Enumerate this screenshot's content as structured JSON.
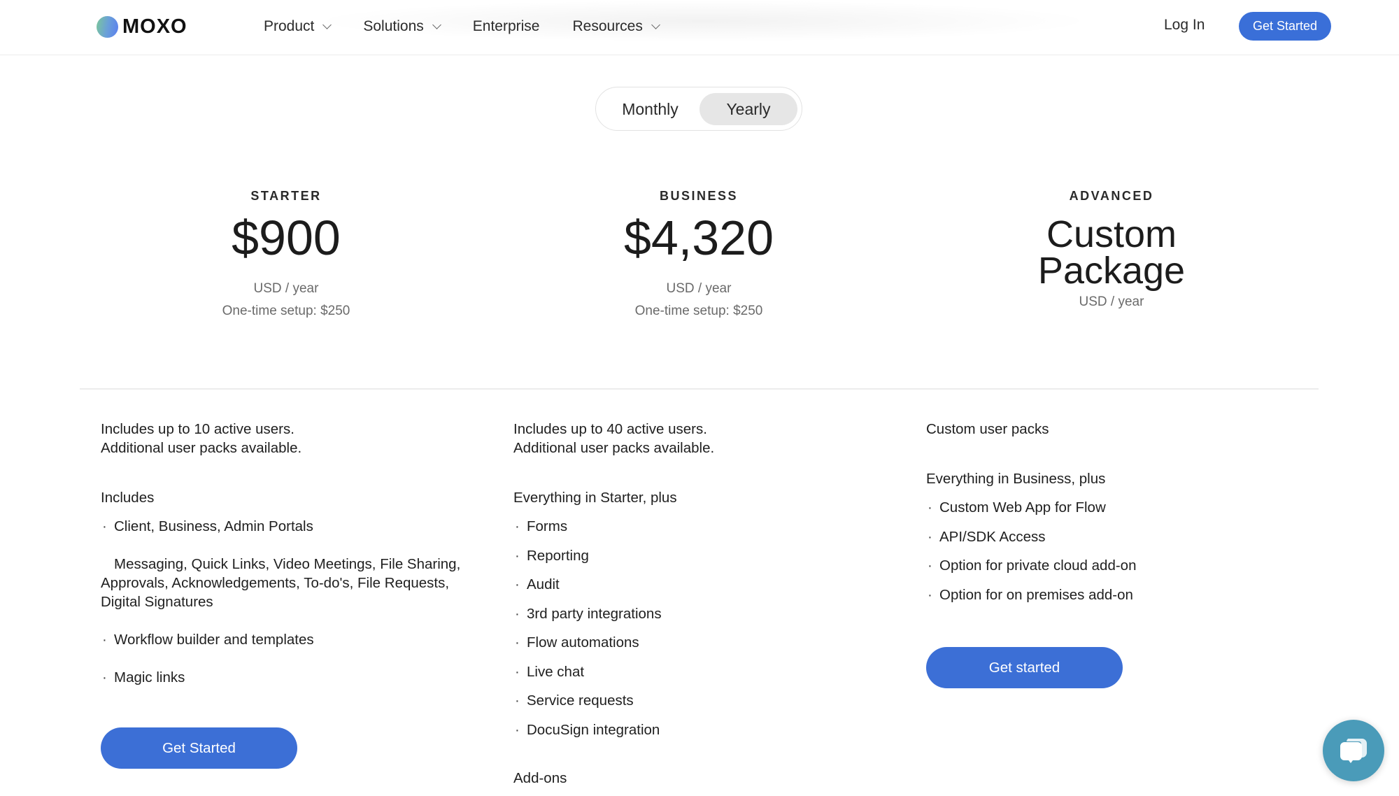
{
  "header": {
    "logo_text": "MOXO",
    "nav": [
      {
        "label": "Product",
        "has_dropdown": true
      },
      {
        "label": "Solutions",
        "has_dropdown": true
      },
      {
        "label": "Enterprise",
        "has_dropdown": false
      },
      {
        "label": "Resources",
        "has_dropdown": true
      }
    ],
    "login_label": "Log In",
    "cta_label": "Get Started"
  },
  "billing_toggle": {
    "options": [
      "Monthly",
      "Yearly"
    ],
    "selected": "Yearly"
  },
  "plans": [
    {
      "name": "STARTER",
      "price": "$900",
      "unit": "USD / year",
      "setup": "One-time setup: $250",
      "users_line1": "Includes up to 10 active users.",
      "users_line2": "Additional user packs available.",
      "section_title": "Includes",
      "features": [
        "Client, Business, Admin Portals",
        "Messaging, Quick Links, Video Meetings, File Sharing, Approvals, Acknowledgements, To-do's, File Requests, Digital Signatures",
        "Workflow builder and templates",
        "Magic links"
      ],
      "cta_label": "Get Started"
    },
    {
      "name": "BUSINESS",
      "price": "$4,320",
      "unit": "USD / year",
      "setup": "One-time setup: $250",
      "users_line1": "Includes up to 40 active users.",
      "users_line2": "Additional user packs available.",
      "section_title": "Everything in Starter, plus",
      "features": [
        "Forms",
        "Reporting",
        "Audit",
        "3rd party integrations",
        "Flow automations",
        "Live chat",
        "Service requests",
        "DocuSign integration"
      ],
      "addons_title": "Add-ons"
    },
    {
      "name": "ADVANCED",
      "price_line1": "Custom",
      "price_line2": "Package",
      "unit": "USD / year",
      "users_line1": "Custom user packs",
      "section_title": "Everything in Business, plus",
      "features": [
        "Custom Web App for Flow",
        "API/SDK Access",
        "Option for private cloud add-on",
        "Option for on premises add-on"
      ],
      "cta_label": "Get started"
    }
  ],
  "chat_widget": {
    "icon": "chat-bubbles-icon"
  },
  "colors": {
    "primary_button": "#3c6fd6",
    "toggle_selected_bg": "#e6e6e6",
    "chat_widget": "#4a9bb9"
  }
}
